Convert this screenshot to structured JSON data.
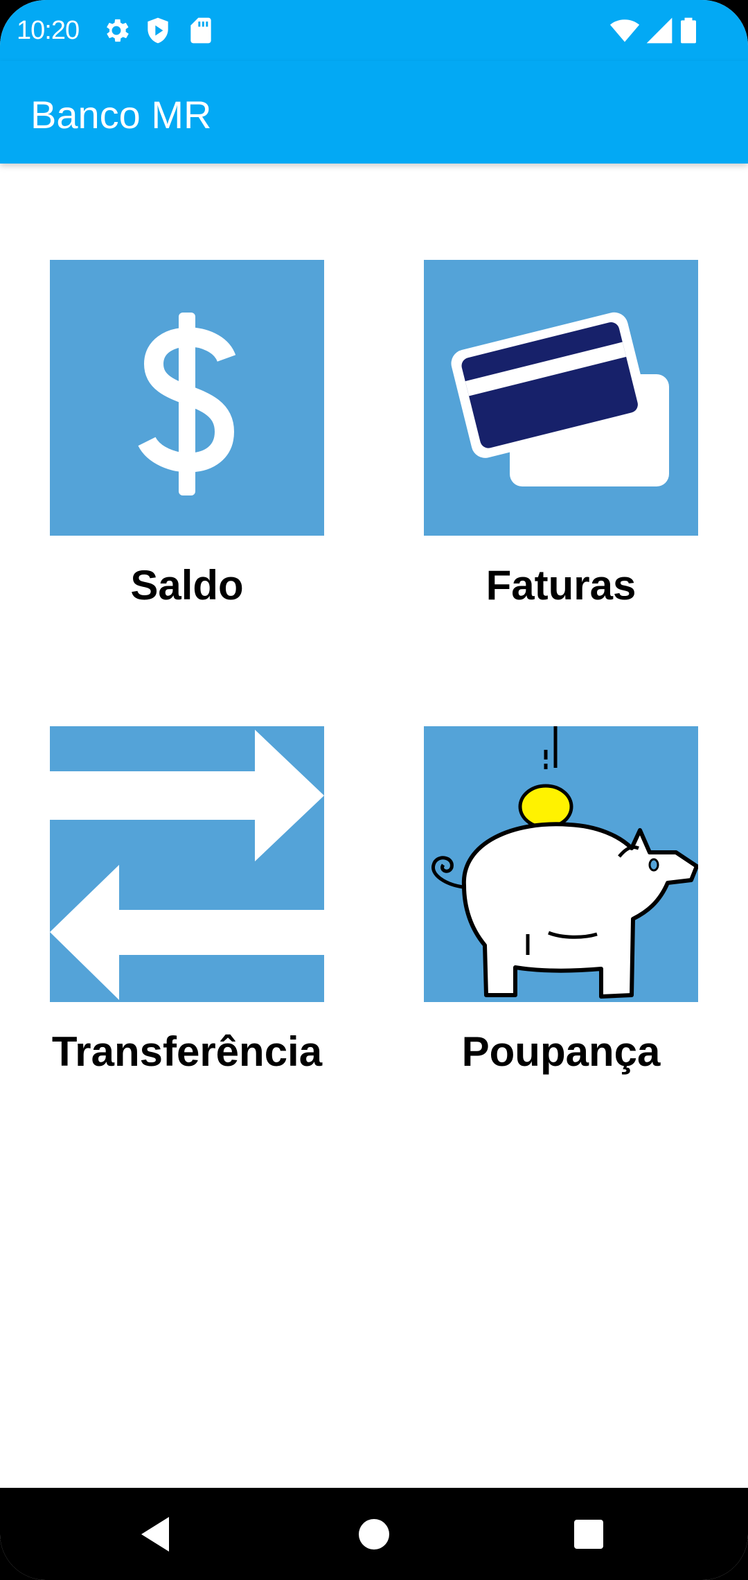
{
  "status_bar": {
    "time": "10:20",
    "left_icons": [
      "gear-icon",
      "shield-play-icon",
      "sd-card-icon"
    ],
    "right_icons": [
      "wifi-icon",
      "signal-icon",
      "battery-icon"
    ]
  },
  "app_bar": {
    "title": "Banco MR"
  },
  "menu": {
    "items": [
      {
        "label": "Saldo",
        "icon": "dollar-icon"
      },
      {
        "label": "Faturas",
        "icon": "credit-cards-icon"
      },
      {
        "label": "Transferência",
        "icon": "transfer-arrows-icon"
      },
      {
        "label": "Poupança",
        "icon": "piggy-bank-icon"
      }
    ]
  },
  "nav_bar": {
    "buttons": [
      "back-icon",
      "home-icon",
      "recents-icon"
    ]
  },
  "colors": {
    "primary": "#03A9F4",
    "tile_background": "#54A3D8",
    "card_navy": "#17216A",
    "coin_yellow": "#FFF200"
  }
}
